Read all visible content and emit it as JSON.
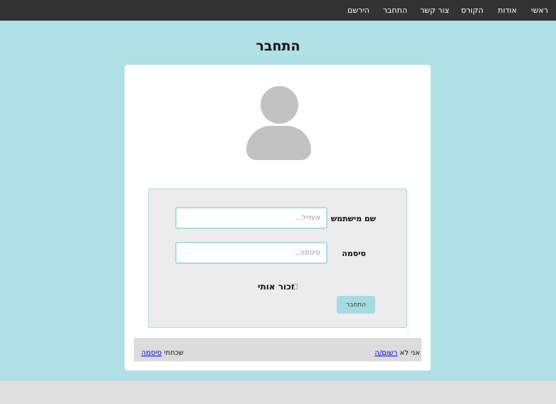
{
  "nav": {
    "items": [
      "ראשי",
      "אודות",
      "הקורס",
      "צור קשר",
      "התחבר",
      "הירשם"
    ]
  },
  "page": {
    "title": "התחבר"
  },
  "form": {
    "username_label": "שם מישתמש",
    "username_placeholder": "אימייל...",
    "password_label": "סיסמה",
    "password_placeholder": "סיסמה...",
    "remember_label": "זכור אותי",
    "remember_checked": false,
    "submit_label": "התחבר"
  },
  "footer": {
    "register_prefix": "אני לא",
    "register_link": "רשום/ה",
    "forgot_prefix": "שכחתי",
    "forgot_link": "סיסמה"
  },
  "colors": {
    "navbar": "#333333",
    "background": "#b0dfe5",
    "accent": "#a7dbe2"
  }
}
